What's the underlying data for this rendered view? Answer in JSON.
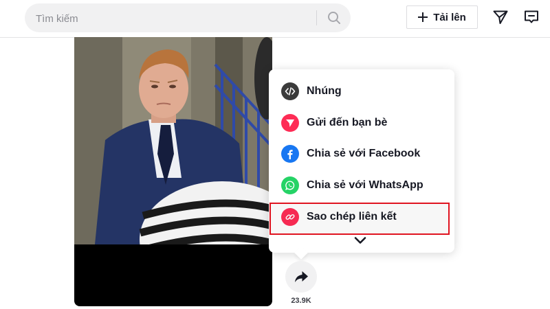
{
  "header": {
    "search": {
      "placeholder": "Tìm kiếm",
      "icon": "search-icon"
    },
    "upload": {
      "label": "Tải lên",
      "icon": "plus-icon"
    },
    "icons": [
      "send-icon",
      "inbox-icon"
    ]
  },
  "share_menu": {
    "items": [
      {
        "label": "Nhúng",
        "icon": "embed-icon",
        "color": "#3b3b3b"
      },
      {
        "label": "Gửi đến bạn bè",
        "icon": "send-icon",
        "color": "#fe2c55"
      },
      {
        "label": "Chia sẻ với Facebook",
        "icon": "facebook-icon",
        "color": "#1877f2"
      },
      {
        "label": "Chia sẻ với WhatsApp",
        "icon": "whatsapp-icon",
        "color": "#25d366"
      },
      {
        "label": "Sao chép liên kết",
        "icon": "link-icon",
        "color": "#fe2c55"
      }
    ],
    "highlighted_item": "Sao chép liên kết",
    "highlight_color": "#e0131f"
  },
  "actions": {
    "share": {
      "icon": "share-arrow-icon",
      "count": "23.9K"
    }
  }
}
